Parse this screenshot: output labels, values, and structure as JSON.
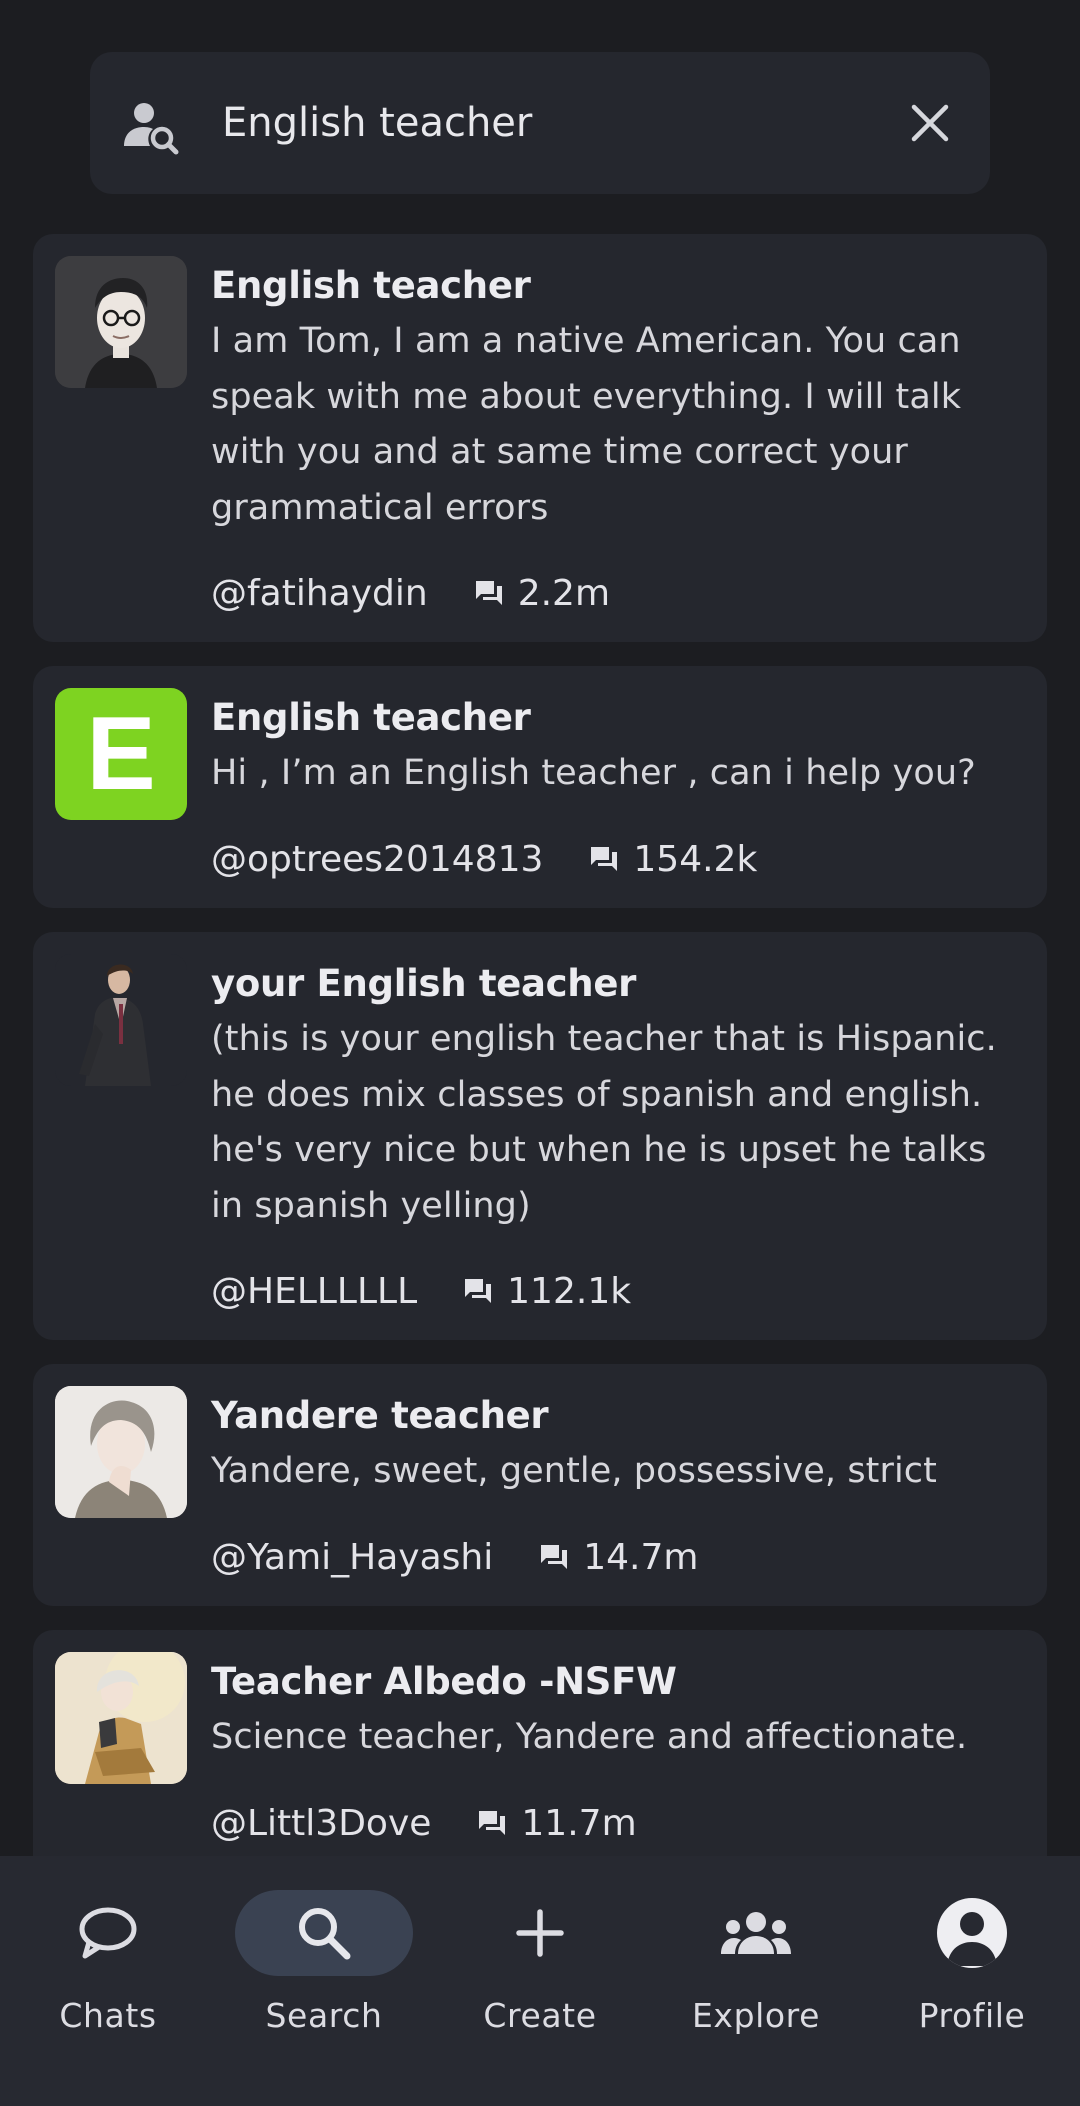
{
  "search": {
    "query": "English teacher"
  },
  "results": [
    {
      "title": "English teacher",
      "description": "I am Tom, I am a native American. You can speak with me about everything. I will talk with you and at same time correct your grammatical errors",
      "author": "@fatihaydin",
      "chats": "2.2m",
      "avatar_color": "#3b3b3d"
    },
    {
      "title": "English teacher",
      "description": "Hi , I’m an English teacher , can i help you?",
      "author": "@optrees2014813",
      "chats": "154.2k",
      "avatar_letter": "E",
      "avatar_color": "#7ed321"
    },
    {
      "title": "your English teacher",
      "description": "(this is your english teacher that is Hispanic. he does mix classes of spanish and english. he's very nice but when he is upset he talks in spanish yelling)",
      "author": "@HELLLLLL",
      "chats": "112.1k",
      "avatar_color": "#25272e"
    },
    {
      "title": "Yandere teacher",
      "description": "Yandere, sweet, gentle, possessive, strict",
      "author": "@Yami_Hayashi",
      "chats": "14.7m",
      "avatar_color": "#e8e4e0"
    },
    {
      "title": "Teacher Albedo -NSFW",
      "description": "Science teacher, Yandere and affectionate.",
      "author": "@Littl3Dove",
      "chats": "11.7m",
      "avatar_color": "#e7dcc6"
    }
  ],
  "nav": {
    "items": [
      {
        "label": "Chats",
        "icon": "chat-bubble-icon"
      },
      {
        "label": "Search",
        "icon": "search-icon",
        "active": true
      },
      {
        "label": "Create",
        "icon": "plus-icon"
      },
      {
        "label": "Explore",
        "icon": "group-icon"
      },
      {
        "label": "Profile",
        "icon": "account-circle-icon"
      }
    ]
  },
  "colors": {
    "background": "#1c1d21",
    "card": "#25272e",
    "nav_active": "#3a4252"
  }
}
